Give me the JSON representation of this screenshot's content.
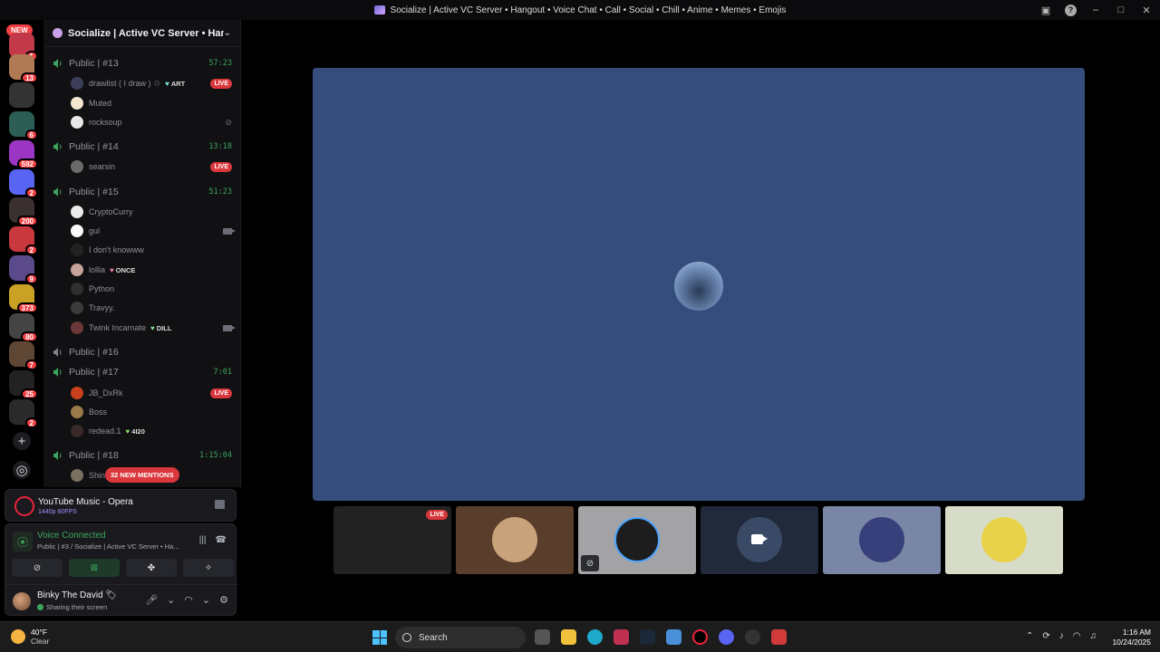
{
  "window": {
    "title": "Socialize | Active VC Server • Hangout • Voice Chat • Call • Social • Chill • Anime • Memes • Emojis"
  },
  "rail": {
    "new_label": "NEW",
    "badges": [
      "1",
      "13",
      "6",
      "592",
      "2",
      "200",
      "2",
      "9",
      "373",
      "80",
      "7",
      "25",
      "2"
    ]
  },
  "server": {
    "name": "Socialize | Active VC Server • Han..."
  },
  "channels": [
    {
      "name": "Public | #13",
      "time": "57:23"
    },
    {
      "name": "Public | #14",
      "time": "13:18"
    },
    {
      "name": "Public | #15",
      "time": "51:23"
    },
    {
      "name": "Public | #16",
      "time": ""
    },
    {
      "name": "Public | #17",
      "time": "7:01"
    },
    {
      "name": "Public | #18",
      "time": "1:15:04"
    }
  ],
  "users": [
    {
      "name": "drawlist ( I draw ) ♲",
      "tag": "ART",
      "right": "LIVE"
    },
    {
      "name": "Muted",
      "tag": "",
      "right": ""
    },
    {
      "name": "rocksoup",
      "tag": "",
      "right": ""
    },
    {
      "name": "searsin",
      "tag": "",
      "right": "LIVE"
    },
    {
      "name": "CryptoCurry",
      "tag": "",
      "right": ""
    },
    {
      "name": "gul",
      "tag": "",
      "right": ""
    },
    {
      "name": "I don't knowww",
      "tag": "",
      "right": ""
    },
    {
      "name": "lollia",
      "tag": "ONCE",
      "right": ""
    },
    {
      "name": "Python",
      "tag": "",
      "right": ""
    },
    {
      "name": "Travyy.",
      "tag": "",
      "right": ""
    },
    {
      "name": "Twink Incarnate",
      "tag": "DILL",
      "right": ""
    },
    {
      "name": "JB_DxRk",
      "tag": "",
      "right": "LIVE"
    },
    {
      "name": "Boss",
      "tag": "",
      "right": ""
    },
    {
      "name": "redead.1",
      "tag": "4I20",
      "right": ""
    },
    {
      "name": "Shin",
      "tag": "",
      "right": ""
    }
  ],
  "mentions": "32 NEW MENTIONS",
  "activity": {
    "title": "YouTube Music - Opera",
    "sub": "1440p 60FPS"
  },
  "voice": {
    "status": "Voice Connected",
    "channel": "Public | #3 / Socialize | Active VC Server • Ha..."
  },
  "me": {
    "name": "Binky The David 🏷",
    "status": "Sharing their screen"
  },
  "stage": {
    "tile_live": "LIVE"
  },
  "taskbar": {
    "temp": "40°F",
    "condition": "Clear",
    "search": "Search",
    "time": "1:16 AM",
    "date": "10/24/2025"
  },
  "colors": {
    "stage_bg": "#354d7c",
    "live": "#da373c",
    "connected": "#3ba55d",
    "blurple": "#5865f2"
  }
}
